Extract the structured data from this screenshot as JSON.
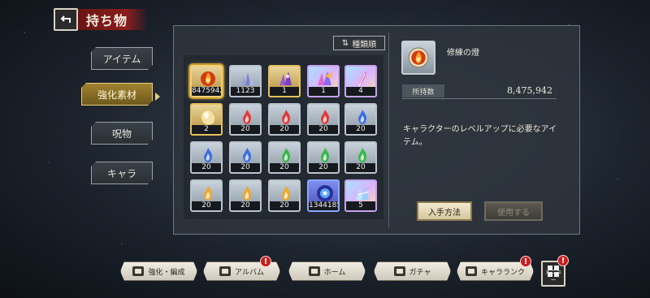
{
  "header": {
    "title": "持ち物"
  },
  "categories": [
    {
      "label": "アイテム",
      "active": false
    },
    {
      "label": "強化素材",
      "active": true
    },
    {
      "label": "呪物",
      "active": false
    },
    {
      "label": "キャラ",
      "active": false
    }
  ],
  "sort": {
    "label": "種類順",
    "icon": "sort-icon"
  },
  "items": [
    {
      "count": "8475942",
      "icon": "fire-orb-icon",
      "frame": "gold",
      "selected": true
    },
    {
      "count": "1123",
      "icon": "crystal-cluster-icon",
      "frame": "silver"
    },
    {
      "count": "1",
      "icon": "purple-crystal-icon",
      "frame": "gold"
    },
    {
      "count": "1",
      "icon": "rainbow-crystal-icon",
      "frame": "rainbow"
    },
    {
      "count": "4",
      "icon": "feather-icon",
      "frame": "rainbow"
    },
    {
      "count": "2",
      "icon": "light-stone-icon",
      "frame": "gold"
    },
    {
      "count": "20",
      "icon": "red-flame-icon",
      "frame": "silver"
    },
    {
      "count": "20",
      "icon": "red-flame-icon",
      "frame": "silver"
    },
    {
      "count": "20",
      "icon": "red-flame-icon",
      "frame": "silver"
    },
    {
      "count": "20",
      "icon": "blue-flame-icon",
      "frame": "silver"
    },
    {
      "count": "20",
      "icon": "blue-flame-icon",
      "frame": "silver"
    },
    {
      "count": "20",
      "icon": "blue-flame-icon",
      "frame": "silver"
    },
    {
      "count": "20",
      "icon": "green-flame-icon",
      "frame": "silver"
    },
    {
      "count": "20",
      "icon": "green-flame-icon",
      "frame": "silver"
    },
    {
      "count": "20",
      "icon": "green-flame-icon",
      "frame": "silver"
    },
    {
      "count": "20",
      "icon": "orange-flame-icon",
      "frame": "silver"
    },
    {
      "count": "20",
      "icon": "orange-flame-icon",
      "frame": "silver"
    },
    {
      "count": "20",
      "icon": "orange-flame-icon",
      "frame": "silver"
    },
    {
      "count": "1344185",
      "icon": "blue-orb-icon",
      "frame": "blue"
    },
    {
      "count": "5",
      "icon": "ice-crystal-icon",
      "frame": "rainbow"
    }
  ],
  "detail": {
    "name": "修練の燈",
    "icon": "fire-orb-icon",
    "count_label": "所持数",
    "count_value": "8,475,942",
    "description": "キャラクターのレベルアップに必要なアイテム。",
    "acquire_label": "入手方法",
    "use_label": "使用する"
  },
  "bottom_nav": [
    {
      "label": "強化・編成",
      "icon": "party-icon",
      "badge": false
    },
    {
      "label": "アルバム",
      "icon": "album-icon",
      "badge": true
    },
    {
      "label": "ホーム",
      "icon": "home-icon",
      "badge": false
    },
    {
      "label": "ガチャ",
      "icon": "gacha-icon",
      "badge": false
    },
    {
      "label": "キャラランク",
      "icon": "rank-icon",
      "badge": true
    }
  ],
  "menu": {
    "label": "メニュー",
    "badge": true,
    "badge_text": "!"
  },
  "colors": {
    "red": "#e23b3b",
    "blue": "#3b6ee2",
    "green": "#36b84a",
    "orange": "#f0a830",
    "purple": "#9b59d6",
    "gold": "#e4c15a",
    "badge": "#c42020"
  }
}
